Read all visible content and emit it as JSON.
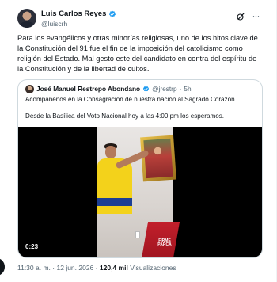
{
  "author": {
    "name": "Luis Carlos Reyes",
    "handle": "@luiscrh",
    "verified_icon": "verified-badge-icon"
  },
  "actions": {
    "grok_icon": "grok-icon",
    "more_icon": "more-icon",
    "more_label": "···"
  },
  "tweet": {
    "text": "Para los evangélicos y otras minorías religiosas, uno de los hitos clave de la Constitución del 91 fue el fin de la imposición del catolicismo como religión del Estado. Mal gesto este del candidato en contra del espíritu de la Constitución y de la libertad de cultos."
  },
  "quote": {
    "name": "José Manuel Restrepo Abondano",
    "handle": "@jrestrp",
    "separator": "·",
    "time": "5h",
    "line1": "Acompáñenos en la Consagración de nuestra nación al Sagrado Corazón.",
    "line2": "Desde la Basílica del Voto Nacional hoy a las 4:00 pm los esperamos.",
    "video": {
      "duration": "0:23",
      "watermark": "FIRME PARCA"
    }
  },
  "meta": {
    "time": "11:30 a. m.",
    "separator": "·",
    "date": "12 jun. 2026",
    "views_count": "120,4 mil",
    "views_label": "Visualizaciones"
  },
  "colors": {
    "verified": "#1d9bf0",
    "text_primary": "#0f1419",
    "text_secondary": "#536471",
    "border": "#cfd9de"
  }
}
